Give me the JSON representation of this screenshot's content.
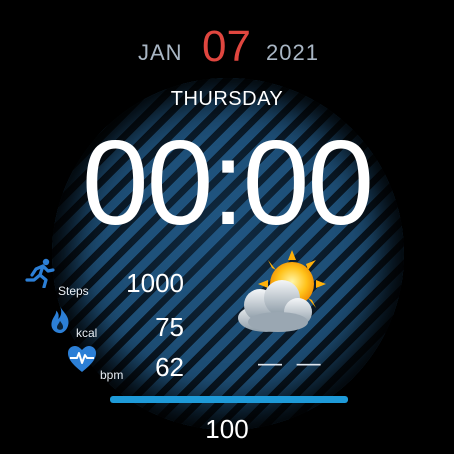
{
  "date": {
    "month": "JAN",
    "day": "07",
    "year": "2021",
    "weekday": "THURSDAY"
  },
  "time": {
    "display": "00:00"
  },
  "stats": {
    "steps": {
      "unit": "Steps",
      "value": "1000",
      "icon": "running-person-icon"
    },
    "calories": {
      "unit": "kcal",
      "value": "75",
      "icon": "flame-icon"
    },
    "heart_rate": {
      "unit": "bpm",
      "value": "62",
      "icon": "heart-pulse-icon"
    }
  },
  "weather": {
    "icon": "partly-cloudy-icon",
    "temperature": "— —"
  },
  "battery": {
    "value": "100",
    "level": 1.0
  },
  "colors": {
    "accent_red": "#e0463f",
    "accent_blue": "#1e9ad8",
    "icon_blue": "#2c7fd6"
  }
}
